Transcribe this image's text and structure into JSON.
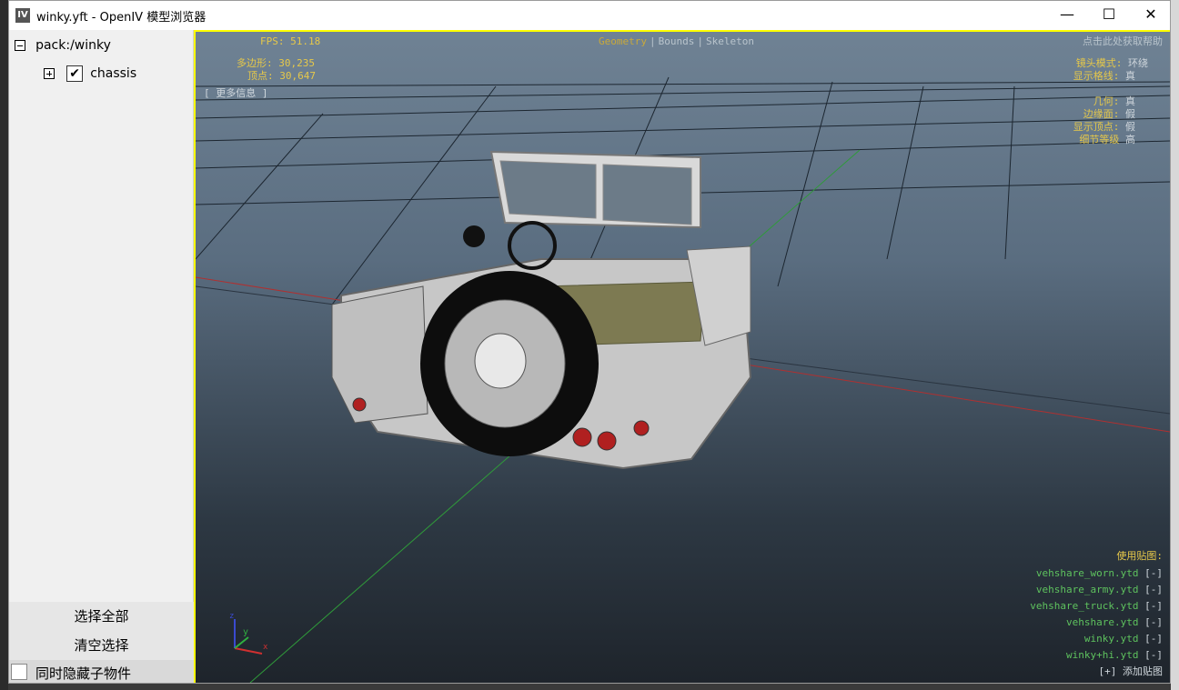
{
  "window": {
    "title": "winky.yft - OpenIV 模型浏览器",
    "icon_label": "IV",
    "controls": {
      "minimize": "—",
      "maximize": "☐",
      "close": "✕"
    }
  },
  "sidebar": {
    "root_label": "pack:/winky",
    "child_label": "chassis",
    "child_checked": "✔",
    "select_all": "选择全部",
    "clear_selection": "清空选择",
    "hide_children": "同时隐藏子物件"
  },
  "viewport": {
    "fps_label": "FPS: 51.18",
    "polygons_label": "多边形: ",
    "polygons_value": "30,235",
    "vertices_label": "顶点: ",
    "vertices_value": "30,647",
    "more_info": "[ 更多信息 ]",
    "tabs": [
      "Geometry",
      "Bounds",
      "Skeleton"
    ],
    "help": "点击此处获取帮助",
    "camera_label": "镜头模式: ",
    "camera_value": "环绕",
    "grid_label": "显示格线: ",
    "grid_value": "真",
    "geometry_label": "几何: ",
    "geometry_value": "真",
    "edges_label": "边缘面: ",
    "edges_value": "假",
    "verts_label": "显示顶点: ",
    "verts_value": "假",
    "lod_label": "细节等级 ",
    "lod_value": "高",
    "textures_title": "使用贴图:",
    "textures": [
      "vehshare_worn.ytd",
      "vehshare_army.ytd",
      "vehshare_truck.ytd",
      "vehshare.ytd",
      "winky.ytd",
      "winky+hi.ytd"
    ],
    "texture_remove": "[-]",
    "add_texture": "[+] 添加贴图",
    "axis_x": "x",
    "axis_y": "y",
    "axis_z": "z"
  },
  "colors": {
    "accent_hud": "#e6c84a",
    "texture_green": "#5ec25e",
    "viewport_border": "#ffff00"
  }
}
